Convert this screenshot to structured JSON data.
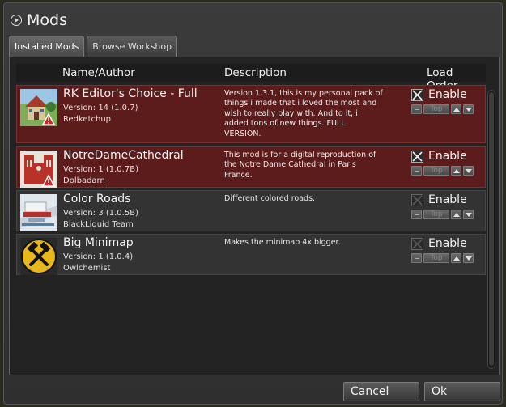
{
  "window": {
    "title": "Mods"
  },
  "tabs": [
    {
      "label": "Installed Mods",
      "active": true
    },
    {
      "label": "Browse Workshop",
      "active": false
    }
  ],
  "columns": {
    "name": "Name/Author",
    "description": "Description",
    "load_order": "Load Order"
  },
  "mods": [
    {
      "name": "RK Editor's Choice - Full",
      "version": "Version: 14 (1.0.7)",
      "author": "Redketchup",
      "description": "Version 1.3.1, this is my personal pack of things i made that i loved the most and wish to really play with. And to it, i added tons of new things. FULL VERSION.",
      "enabled": true,
      "warning": true,
      "thumb": "house-thumbnail",
      "enable_label": "Enable",
      "top_label": "Top"
    },
    {
      "name": "NotreDameCathedral",
      "version": "Version: 1 (1.0.7B)",
      "author": "Dolbadarn",
      "description": "This mod is for a digital reproduction of the Notre Dame Cathedral in Paris France.",
      "enabled": true,
      "warning": true,
      "thumb": "cathedral-thumbnail",
      "enable_label": "Enable",
      "top_label": "Top"
    },
    {
      "name": "Color Roads",
      "version": "Version: 3 (1.0.5B)",
      "author": "BlackLiquid Team",
      "description": "Different colored roads.",
      "enabled": false,
      "warning": false,
      "thumb": "roads-thumbnail",
      "enable_label": "Enable",
      "top_label": "Top"
    },
    {
      "name": "Big Minimap",
      "version": "Version: 1 (1.0.4)",
      "author": "Owlchemist",
      "description": "Makes the minimap 4x bigger.",
      "enabled": false,
      "warning": false,
      "thumb": "hammers-thumbnail",
      "enable_label": "Enable",
      "top_label": "Top"
    }
  ],
  "footer": {
    "cancel": "Cancel",
    "ok": "Ok"
  }
}
